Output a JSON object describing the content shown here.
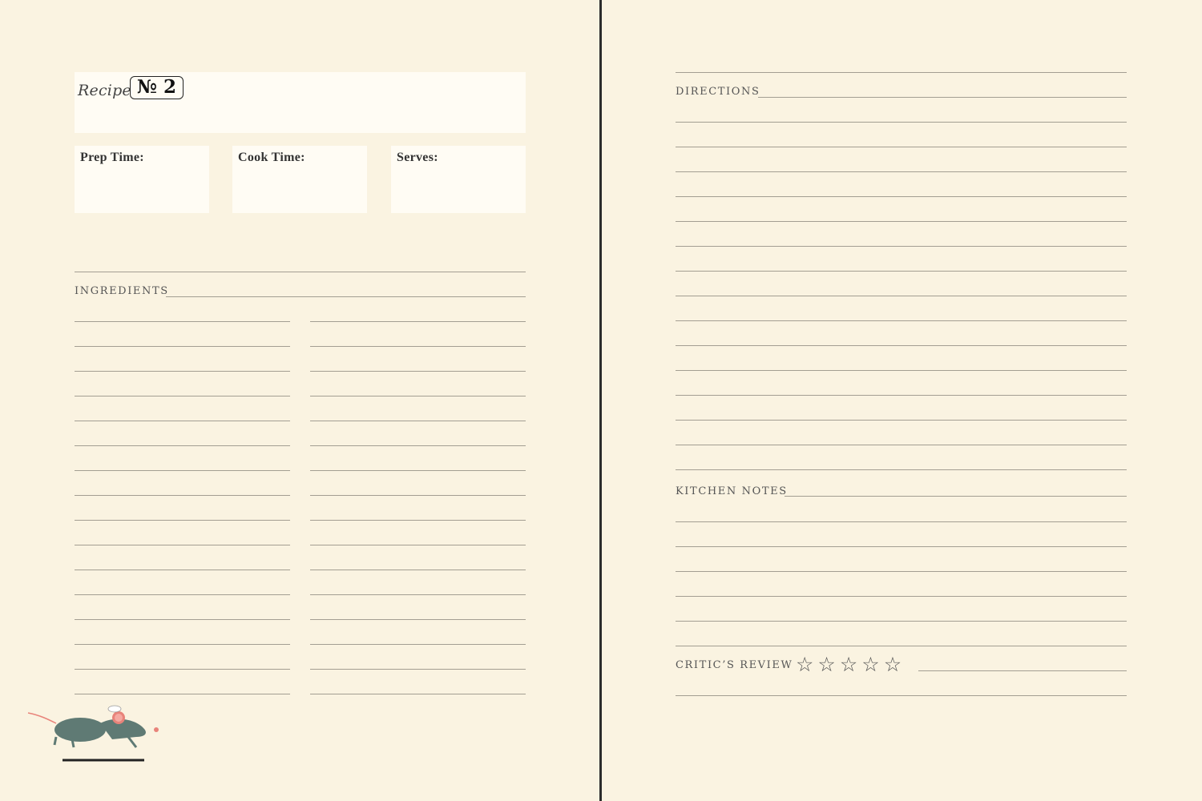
{
  "recipe": {
    "label": "Recipe",
    "number": "№ 2"
  },
  "fields": [
    {
      "label": "Prep Time:"
    },
    {
      "label": "Cook Time:"
    },
    {
      "label": "Serves:"
    }
  ],
  "sections": {
    "ingredients": "INGREDIENTS",
    "directions": "DIRECTIONS",
    "kitchen_notes": "KITCHEN NOTES",
    "critics_review": "CRITIC’S REVIEW"
  },
  "rating": {
    "max_stars": 5,
    "filled_stars": 0,
    "star_glyph": "☆"
  },
  "colors": {
    "paper": "#faf3e1",
    "box": "#fffcf4",
    "rule": "#a39e92",
    "gutter": "#2c2c2c",
    "mouse_body": "#5f7a74",
    "mouse_ear": "#e8837a"
  }
}
